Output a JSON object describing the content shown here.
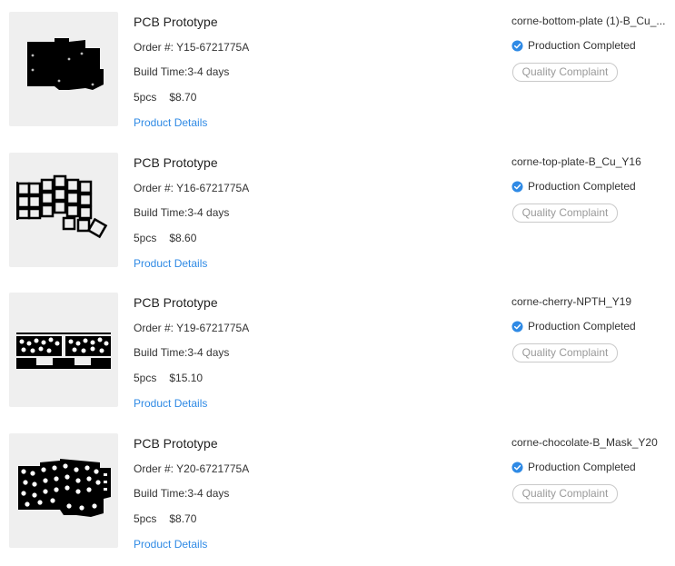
{
  "colors": {
    "link": "#2f8ae5",
    "status_check": "#2f8ae5",
    "thumb_bg": "#efefef"
  },
  "orders": [
    {
      "title": "PCB Prototype",
      "order_label": "Order #: ",
      "order_no": "Y15-6721775A",
      "build_label": "Build Time:",
      "build_time": "3-4 days",
      "qty": "5pcs",
      "price": "$8.70",
      "details": "Product Details",
      "filename": "corne-bottom-plate (1)-B_Cu_...",
      "status": "Production Completed",
      "complaint": "Quality Complaint",
      "thumb_icon": "pcb-bottom-plate-thumbnail"
    },
    {
      "title": "PCB Prototype",
      "order_label": "Order #: ",
      "order_no": "Y16-6721775A",
      "build_label": "Build Time:",
      "build_time": "3-4 days",
      "qty": "5pcs",
      "price": "$8.60",
      "details": "Product Details",
      "filename": "corne-top-plate-B_Cu_Y16",
      "status": "Production Completed",
      "complaint": "Quality Complaint",
      "thumb_icon": "pcb-top-plate-thumbnail"
    },
    {
      "title": "PCB Prototype",
      "order_label": "Order #: ",
      "order_no": "Y19-6721775A",
      "build_label": "Build Time:",
      "build_time": "3-4 days",
      "qty": "5pcs",
      "price": "$15.10",
      "details": "Product Details",
      "filename": "corne-cherry-NPTH_Y19",
      "status": "Production Completed",
      "complaint": "Quality Complaint",
      "thumb_icon": "pcb-cherry-thumbnail"
    },
    {
      "title": "PCB Prototype",
      "order_label": "Order #: ",
      "order_no": "Y20-6721775A",
      "build_label": "Build Time:",
      "build_time": "3-4 days",
      "qty": "5pcs",
      "price": "$8.70",
      "details": "Product Details",
      "filename": "corne-chocolate-B_Mask_Y20",
      "status": "Production Completed",
      "complaint": "Quality Complaint",
      "thumb_icon": "pcb-chocolate-thumbnail"
    }
  ]
}
